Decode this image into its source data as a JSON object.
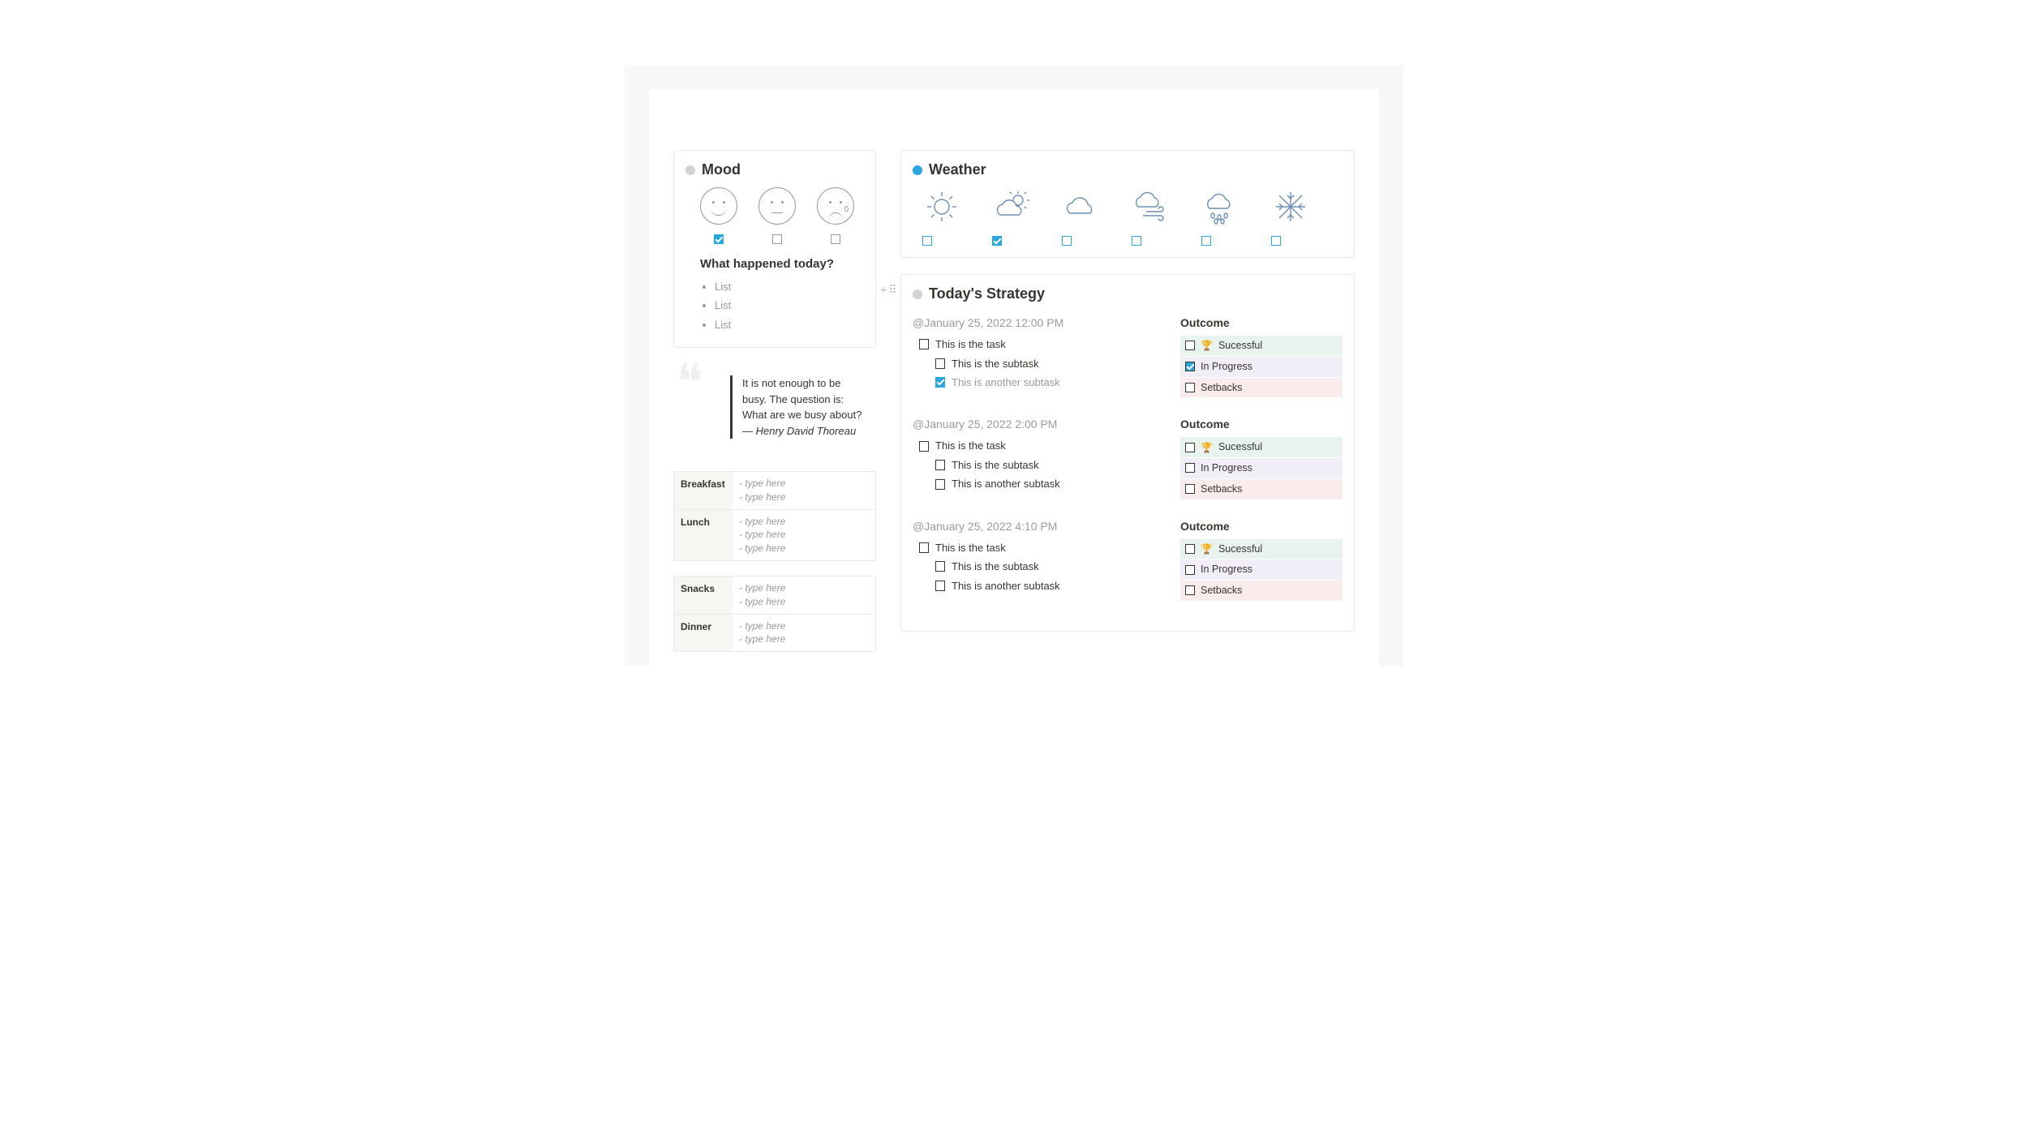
{
  "mood": {
    "title": "Mood",
    "options": [
      {
        "face": "smile",
        "checked": true
      },
      {
        "face": "neutral",
        "checked": false
      },
      {
        "face": "sad",
        "checked": false
      }
    ],
    "prompt": "What happened today?",
    "bullets": [
      "List",
      "List",
      "List"
    ]
  },
  "quote": {
    "text": "It is not enough to be busy. The question is: What are we busy about? — ",
    "author": "Henry David Thoreau"
  },
  "meals": {
    "group1": [
      {
        "label": "Breakfast",
        "lines": [
          "- type here",
          "- type here"
        ]
      },
      {
        "label": "Lunch",
        "lines": [
          "- type here",
          "- type here",
          "- type here"
        ]
      }
    ],
    "group2": [
      {
        "label": "Snacks",
        "lines": [
          "- type here",
          "- type here"
        ]
      },
      {
        "label": "Dinner",
        "lines": [
          "- type here",
          "- type here"
        ]
      }
    ]
  },
  "weather": {
    "title": "Weather",
    "options": [
      {
        "icon": "sun",
        "checked": false
      },
      {
        "icon": "partly-cloudy",
        "checked": true
      },
      {
        "icon": "cloud",
        "checked": false
      },
      {
        "icon": "wind",
        "checked": false
      },
      {
        "icon": "rain",
        "checked": false
      },
      {
        "icon": "snow",
        "checked": false
      }
    ]
  },
  "strategy": {
    "title": "Today's Strategy",
    "outcome_heading": "Outcome",
    "outcome_labels": {
      "successful": "Sucessful",
      "in_progress": "In Progress",
      "setbacks": "Setbacks"
    },
    "slots": [
      {
        "time": "January 25, 2022 12:00 PM",
        "tasks": [
          {
            "text": "This is the task",
            "checked": false,
            "level": 0
          },
          {
            "text": "This is the subtask",
            "checked": false,
            "level": 1
          },
          {
            "text": "This is another subtask",
            "checked": true,
            "level": 1
          }
        ],
        "outcome": {
          "successful": false,
          "in_progress": true,
          "setbacks": false
        }
      },
      {
        "time": "January 25, 2022 2:00 PM",
        "tasks": [
          {
            "text": "This is the task",
            "checked": false,
            "level": 0
          },
          {
            "text": "This is the subtask",
            "checked": false,
            "level": 1
          },
          {
            "text": "This is another subtask",
            "checked": false,
            "level": 1
          }
        ],
        "outcome": {
          "successful": false,
          "in_progress": false,
          "setbacks": false
        }
      },
      {
        "time": "January 25, 2022 4:10 PM",
        "tasks": [
          {
            "text": "This is the task",
            "checked": false,
            "level": 0
          },
          {
            "text": "This is the subtask",
            "checked": false,
            "level": 1
          },
          {
            "text": "This is another subtask",
            "checked": false,
            "level": 1
          }
        ],
        "outcome": {
          "successful": false,
          "in_progress": false,
          "setbacks": false
        }
      }
    ]
  }
}
